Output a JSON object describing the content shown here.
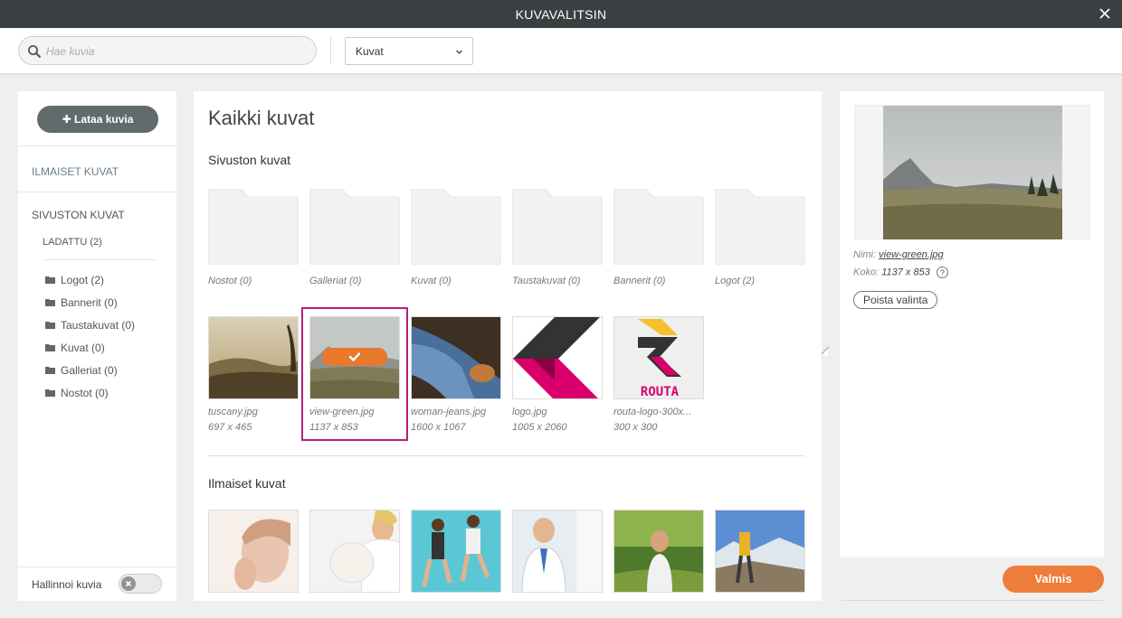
{
  "window": {
    "title": "KUVAVALITSIN"
  },
  "toolbar": {
    "search_placeholder": "Hae kuvia",
    "filter_value": "Kuvat"
  },
  "sidebar": {
    "upload_label": "Lataa kuvia",
    "free_images": "ILMAISET KUVAT",
    "site_images": "SIVUSTON KUVAT",
    "uploaded": "LADATTU (2)",
    "folders": [
      "Logot (2)",
      "Bannerit (0)",
      "Taustakuvat (0)",
      "Kuvat (0)",
      "Galleriat (0)",
      "Nostot (0)"
    ],
    "manage_label": "Hallinnoi kuvia"
  },
  "main": {
    "title": "Kaikki kuvat",
    "site_section": "Sivuston kuvat",
    "folders": [
      "Nostot (0)",
      "Galleriat (0)",
      "Kuvat (0)",
      "Taustakuvat (0)",
      "Bannerit (0)",
      "Logot (2)"
    ],
    "images": [
      {
        "name": "tuscany.jpg",
        "size": "697 x 465"
      },
      {
        "name": "view-green.jpg",
        "size": "1137 x 853"
      },
      {
        "name": "woman-jeans.jpg",
        "size": "1600 x 1067"
      },
      {
        "name": "logo.jpg",
        "size": "1005 x 2060"
      },
      {
        "name": "routa-logo-300x...",
        "size": "300 x 300"
      }
    ],
    "selected_index": 1,
    "free_section": "Ilmaiset kuvat",
    "logo_text": "ROUTA"
  },
  "details": {
    "name_label": "Nimi:",
    "name_value": "view-green.jpg",
    "size_label": "Koko:",
    "size_value": "1137 x 853",
    "help": "?",
    "deselect_label": "Poista valinta",
    "done_label": "Valmis"
  },
  "colors": {
    "accent_orange": "#ee7d3b",
    "selection_magenta": "#b3207a",
    "titlebar": "#3b3f41"
  }
}
